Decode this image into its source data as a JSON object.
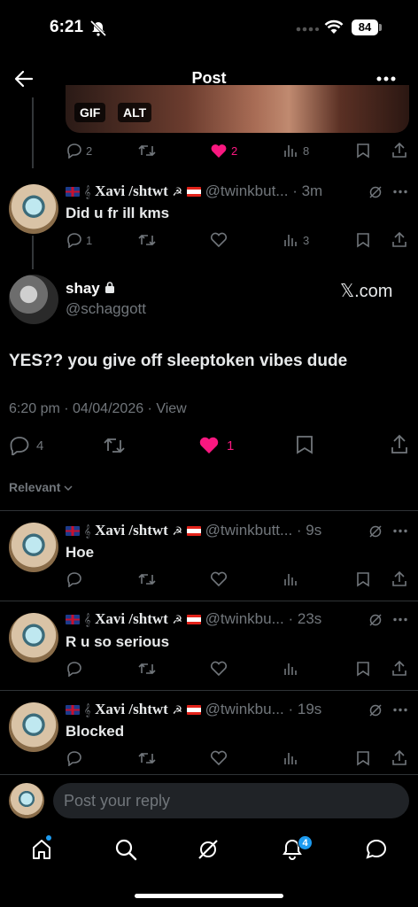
{
  "status_bar": {
    "time": "6:21",
    "battery": "84"
  },
  "header": {
    "title": "Post",
    "back_icon": "arrow-left-icon",
    "more_icon": "more-horizontal-icon"
  },
  "media": {
    "gif_label": "GIF",
    "alt_label": "ALT"
  },
  "parent_stats": {
    "replies": "2",
    "likes": "2",
    "views": "8"
  },
  "reply1": {
    "display_name": "Xavi /shtwt",
    "handle": "@twinkbut...",
    "time": "· 3m",
    "text": "Did u fr ill kms",
    "replies": "1",
    "views": "3"
  },
  "main_post": {
    "name": "shay",
    "handle": "@schaggott",
    "source": "𝕏.com",
    "text": "YES?? you give off sleeptoken vibes dude",
    "timestamp": "6:20 pm · 04/04/2026 · ",
    "view_label": "View",
    "replies": "4",
    "likes": "1"
  },
  "sort_label": "Relevant",
  "replies": [
    {
      "display_name": "Xavi /shtwt",
      "handle": "@twinkbutt...",
      "time": "· 9s",
      "text": "Hoe"
    },
    {
      "display_name": "Xavi /shtwt",
      "handle": "@twinkbu...",
      "time": "· 23s",
      "text": "R u so serious"
    },
    {
      "display_name": "Xavi /shtwt",
      "handle": "@twinkbu...",
      "time": "· 19s",
      "text": "Blocked"
    }
  ],
  "composer": {
    "placeholder": "Post your reply"
  },
  "tab_bar": {
    "notification_count": "4"
  },
  "colors": {
    "like_pink": "#f91880",
    "accent_blue": "#1d9bf0",
    "muted": "#71767b"
  }
}
